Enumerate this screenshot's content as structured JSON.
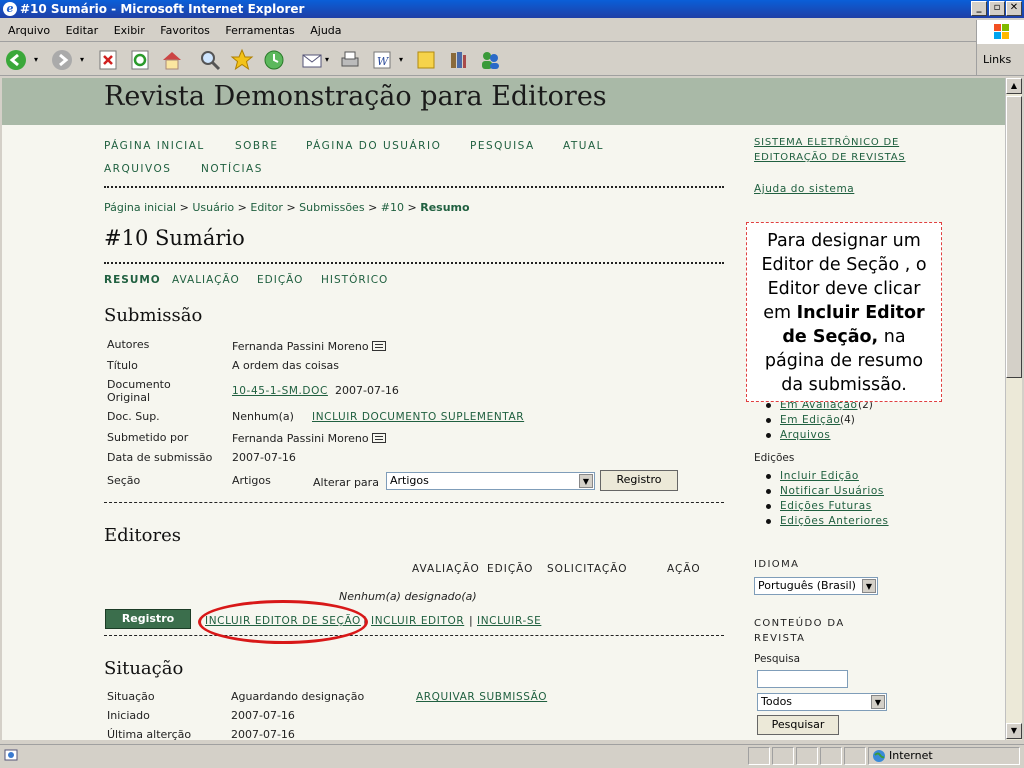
{
  "window": {
    "title": "#10 Sumário - Microsoft Internet Explorer"
  },
  "menu": [
    "Arquivo",
    "Editar",
    "Exibir",
    "Favoritos",
    "Ferramentas",
    "Ajuda"
  ],
  "toolbar": {
    "links_label": "Links"
  },
  "site": {
    "title": "Revista Demonstração para Editores"
  },
  "nav": [
    "PÁGINA INICIAL",
    "SOBRE",
    "PÁGINA DO USUÁRIO",
    "PESQUISA",
    "ATUAL",
    "ARQUIVOS",
    "NOTÍCIAS"
  ],
  "breadcrumb": {
    "items": [
      "Página inicial",
      "Usuário",
      "Editor",
      "Submissões",
      "#10"
    ],
    "current": "Resumo",
    "sep": ">"
  },
  "page": {
    "title": "#10 Sumário"
  },
  "tabs": [
    "RESUMO",
    "AVALIAÇÃO",
    "EDIÇÃO",
    "HISTÓRICO"
  ],
  "submission": {
    "heading": "Submissão",
    "authors_label": "Autores",
    "authors": "Fernanda Passini Moreno",
    "title_label": "Título",
    "title": "A ordem das coisas",
    "doc_label_1": "Documento",
    "doc_label_2": "Original",
    "doc_file": "10-45-1-SM.DOC",
    "doc_date": "2007-07-16",
    "supp_label": "Doc. Sup.",
    "supp_value": "Nenhum(a)",
    "supp_link": "INCLUIR DOCUMENTO SUPLEMENTAR",
    "submitter_label": "Submetido por",
    "submitter": "Fernanda Passini Moreno",
    "date_label": "Data de submissão",
    "date": "2007-07-16",
    "section_label": "Seção",
    "section": "Artigos",
    "change_label": "Alterar para",
    "change_value": "Artigos",
    "record_button": "Registro"
  },
  "editors": {
    "heading": "Editores",
    "columns": [
      "AVALIAÇÃO",
      "EDIÇÃO",
      "SOLICITAÇÃO",
      "AÇÃO"
    ],
    "empty": "Nenhum(a) designado(a)",
    "record_button": "Registro",
    "add_section_editor": "INCLUIR EDITOR DE SEÇÃO",
    "add_editor": "INCLUIR EDITOR",
    "add_self": "INCLUIR-SE",
    "sep": "|"
  },
  "status": {
    "heading": "Situação",
    "status_label": "Situação",
    "status_value": "Aguardando designação",
    "archive_link": "ARQUIVAR SUBMISSÃO",
    "started_label": "Iniciado",
    "started": "2007-07-16",
    "changed_label": "Última alterção",
    "changed": "2007-07-16"
  },
  "sidebar": {
    "system_link_1": "SISTEMA ELETRÔNICO DE",
    "system_link_2": "EDITORAÇÃO DE REVISTAS",
    "help": "Ajuda do sistema",
    "submissions": [
      {
        "label": "Em Avaliação",
        "count": "(2)"
      },
      {
        "label": "Em Edição",
        "count": "(4)"
      },
      {
        "label": "Arquivos",
        "count": ""
      }
    ],
    "issues_label": "Edições",
    "issues": [
      "Incluir Edição",
      "Notificar Usuários",
      "Edições Futuras",
      "Edições Anteriores"
    ],
    "language_label": "IDIOMA",
    "language": "Português (Brasil)",
    "content_label_1": "CONTEÚDO DA",
    "content_label_2": "REVISTA",
    "search_label": "Pesquisa",
    "search_value": "",
    "scope": "Todos",
    "search_button": "Pesquisar"
  },
  "callout": {
    "pre": "Para designar um Editor de Seção , o Editor deve clicar em ",
    "bold": "Incluir Editor de Seção,",
    "post": " na página de resumo da submissão."
  },
  "statusbar": {
    "zone": "Internet"
  }
}
